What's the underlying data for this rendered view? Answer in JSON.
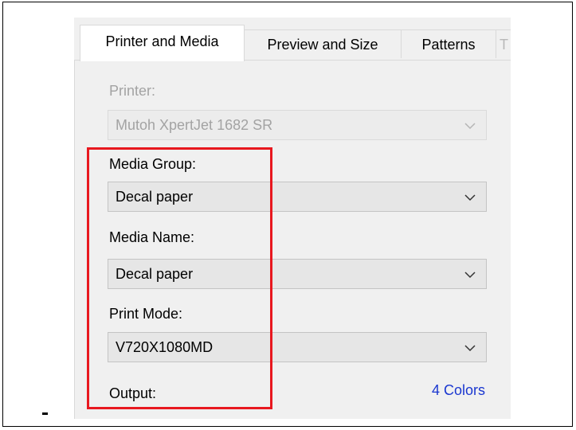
{
  "tabs": [
    {
      "label": "Printer and Media",
      "active": true
    },
    {
      "label": "Preview and Size",
      "active": false
    },
    {
      "label": "Patterns",
      "active": false
    },
    {
      "label": "T",
      "active": false
    }
  ],
  "printer": {
    "label": "Printer:",
    "value": "Mutoh XpertJet 1682 SR",
    "disabled": true
  },
  "media_group": {
    "label": "Media Group:",
    "value": "Decal paper"
  },
  "media_name": {
    "label": "Media Name:",
    "value": "Decal paper"
  },
  "print_mode": {
    "label": "Print Mode:",
    "value": "V720X1080MD"
  },
  "output": {
    "label": "Output:",
    "value": "4 Colors"
  },
  "colors": {
    "highlight": "#e8181f",
    "link": "#1a37d0",
    "panel_bg": "#f0f0f0"
  },
  "icons": {
    "dropdown": "chevron-down-icon"
  }
}
